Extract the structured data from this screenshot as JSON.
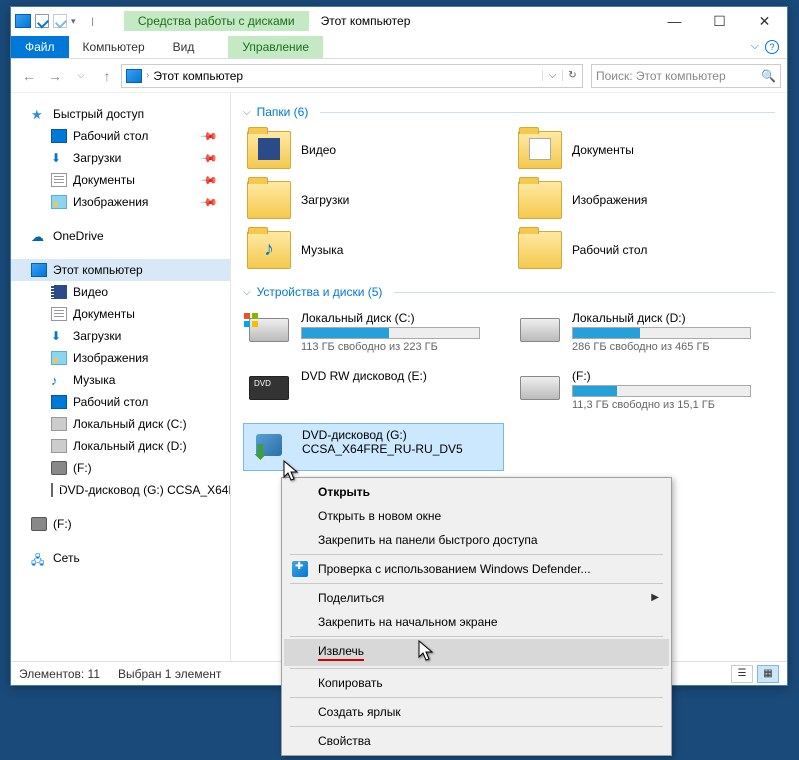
{
  "titlebar": {
    "tooltab": "Средства работы с дисками",
    "title": "Этот компьютер"
  },
  "ribbon": {
    "file": "Файл",
    "computer": "Компьютер",
    "view": "Вид",
    "manage": "Управление"
  },
  "nav": {
    "breadcrumb": "Этот компьютер",
    "search_placeholder": "Поиск: Этот компьютер"
  },
  "sidebar": {
    "quick_access": "Быстрый доступ",
    "desktop": "Рабочий стол",
    "downloads": "Загрузки",
    "documents": "Документы",
    "pictures": "Изображения",
    "onedrive": "OneDrive",
    "this_pc": "Этот компьютер",
    "videos": "Видео",
    "documents2": "Документы",
    "downloads2": "Загрузки",
    "pictures2": "Изображения",
    "music": "Музыка",
    "desktop2": "Рабочий стол",
    "local_c": "Локальный диск (C:)",
    "local_d": "Локальный диск (D:)",
    "drive_f": " (F:)",
    "dvd_g": "DVD-дисковод (G:) CCSA_X64F",
    "drive_f2": " (F:)",
    "network": "Сеть"
  },
  "groups": {
    "folders_hdr": "Папки (6)",
    "drives_hdr": "Устройства и диски (5)"
  },
  "folders": {
    "videos": "Видео",
    "documents": "Документы",
    "downloads": "Загрузки",
    "pictures": "Изображения",
    "music": "Музыка",
    "desktop": "Рабочий стол"
  },
  "drives": {
    "c": {
      "name": "Локальный диск (C:)",
      "free": "113 ГБ свободно из 223 ГБ",
      "pct": 49
    },
    "d": {
      "name": "Локальный диск (D:)",
      "free": "286 ГБ свободно из 465 ГБ",
      "pct": 38
    },
    "e": {
      "name": "DVD RW дисковод (E:)"
    },
    "f": {
      "name": " (F:)",
      "free": "11,3 ГБ свободно из 15,1 ГБ",
      "pct": 25
    },
    "g": {
      "name": "DVD-дисковод (G:)",
      "label": "CCSA_X64FRE_RU-RU_DV5"
    }
  },
  "statusbar": {
    "count": "Элементов: 11",
    "selected": "Выбран 1 элемент"
  },
  "ctx": {
    "open": "Открыть",
    "open_new": "Открыть в новом окне",
    "pin_qa": "Закрепить на панели быстрого доступа",
    "defender": "Проверка с использованием Windows Defender...",
    "share": "Поделиться",
    "pin_start": "Закрепить на начальном экране",
    "eject": "Извлечь",
    "copy": "Копировать",
    "shortcut": "Создать ярлык",
    "properties": "Свойства"
  }
}
